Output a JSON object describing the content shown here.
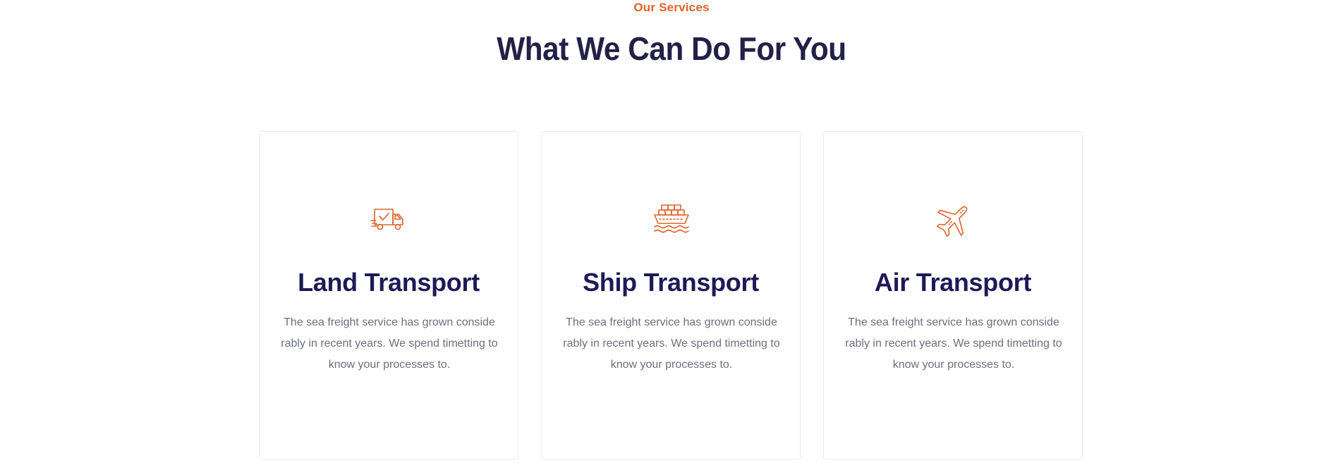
{
  "section": {
    "eyebrow": "Our Services",
    "heading": "What We Can Do For You"
  },
  "cards": [
    {
      "icon": "truck-icon",
      "title": "Land Transport",
      "text": "The sea freight service has grown conside rably in recent years. We spend timetting to know your processes to."
    },
    {
      "icon": "ship-icon",
      "title": "Ship Transport",
      "text": "The sea freight service has grown conside rably in recent years. We spend timetting to know your processes to."
    },
    {
      "icon": "airplane-icon",
      "title": "Air Transport",
      "text": "The sea freight service has grown conside rably in recent years. We spend timetting to know your processes to."
    }
  ],
  "colors": {
    "accent": "#e0632a",
    "heading": "#232147",
    "title": "#1e1a57",
    "body_text": "#6c6f7d",
    "card_border": "#ebebeb"
  }
}
